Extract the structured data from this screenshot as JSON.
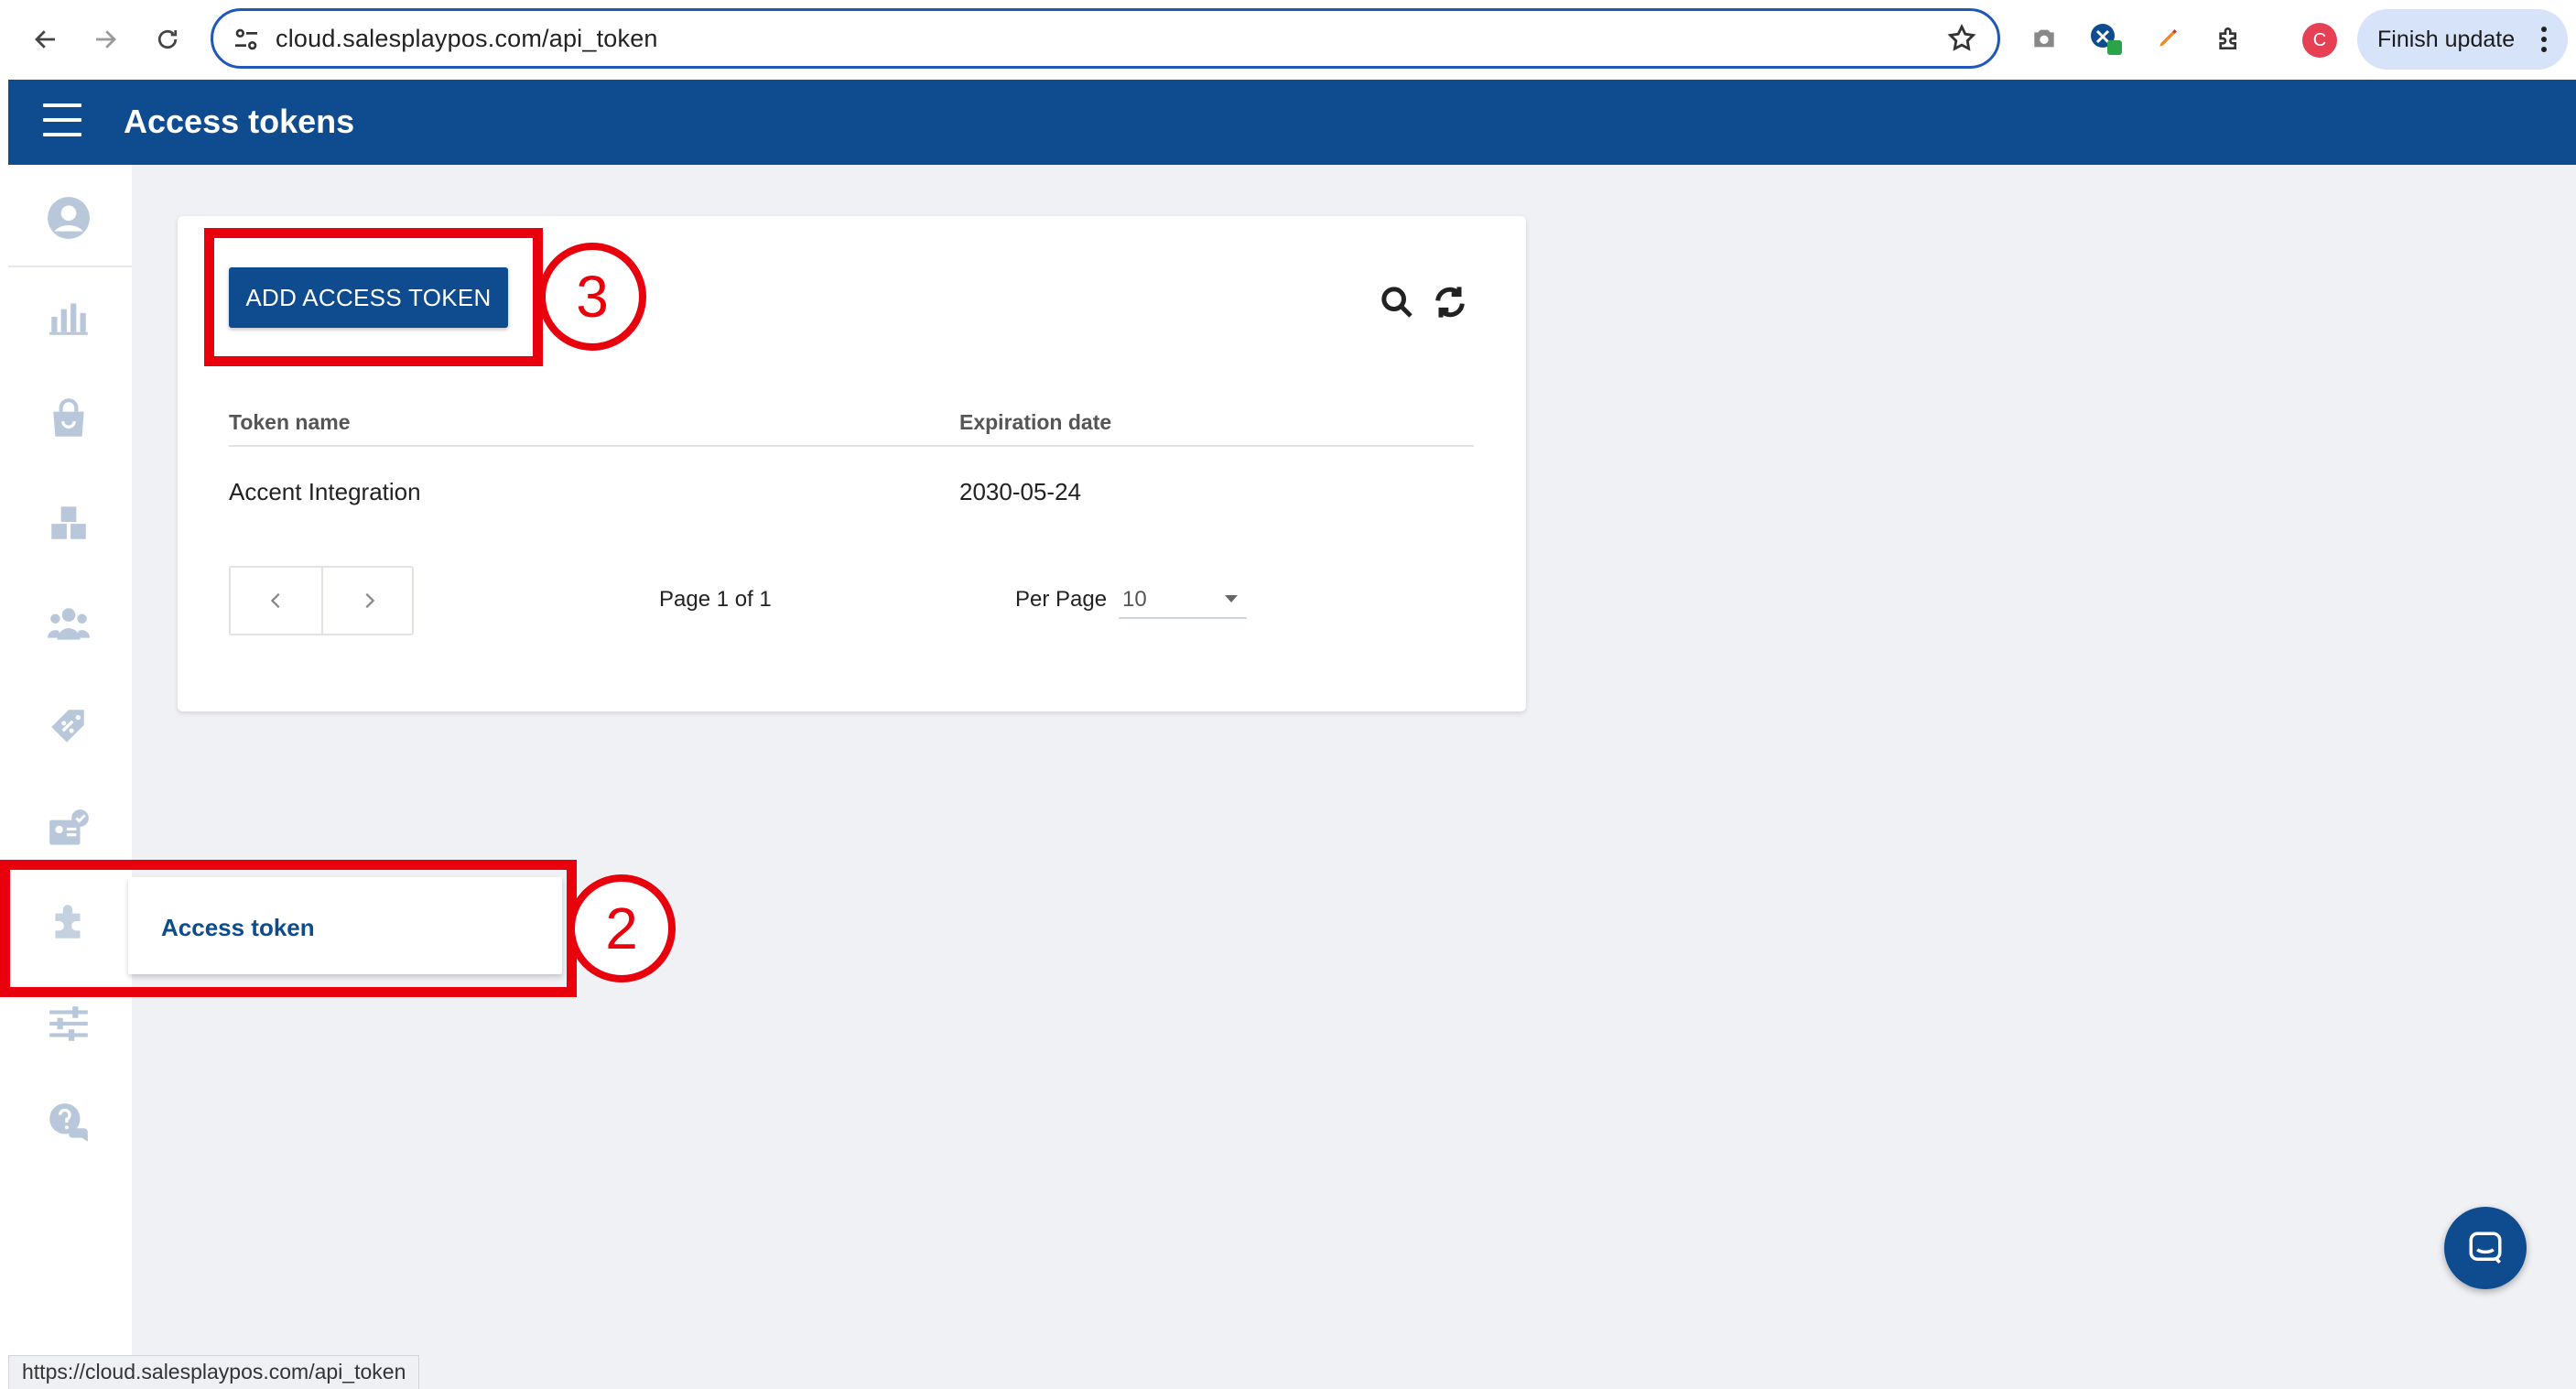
{
  "browser": {
    "url": "cloud.salesplaypos.com/api_token",
    "profile_initial": "C",
    "finish_update_label": "Finish update",
    "status_url": "https://cloud.salesplaypos.com/api_token",
    "icons": [
      "back-arrow-icon",
      "forward-arrow-icon",
      "reload-icon",
      "site-settings-icon",
      "bookmark-star-icon",
      "camera-icon",
      "extension-icon",
      "pen-icon",
      "puzzle-icon",
      "more-vert-icon"
    ]
  },
  "header": {
    "title": "Access tokens"
  },
  "sidebar": {
    "items": [
      "profile-icon",
      "reports-icon",
      "shopping-bag-icon",
      "inventory-icon",
      "customers-icon",
      "discount-icon",
      "employees-icon",
      "integrations-icon",
      "settings-icon",
      "help-icon"
    ]
  },
  "flyout": {
    "label": "Access token"
  },
  "card": {
    "add_button_label": "ADD ACCESS TOKEN",
    "columns": [
      "Token name",
      "Expiration date"
    ],
    "rows": [
      {
        "token_name": "Accent Integration",
        "expiration_date": "2030-05-24"
      }
    ],
    "page_info": "Page 1 of 1",
    "per_page_label": "Per Page",
    "per_page_value": "10"
  },
  "annotations": {
    "step_2": "2",
    "step_3": "3",
    "accent_color": "#e8000c"
  },
  "colors": {
    "brand": "#0e4c8f",
    "background": "#f0f1f5"
  }
}
